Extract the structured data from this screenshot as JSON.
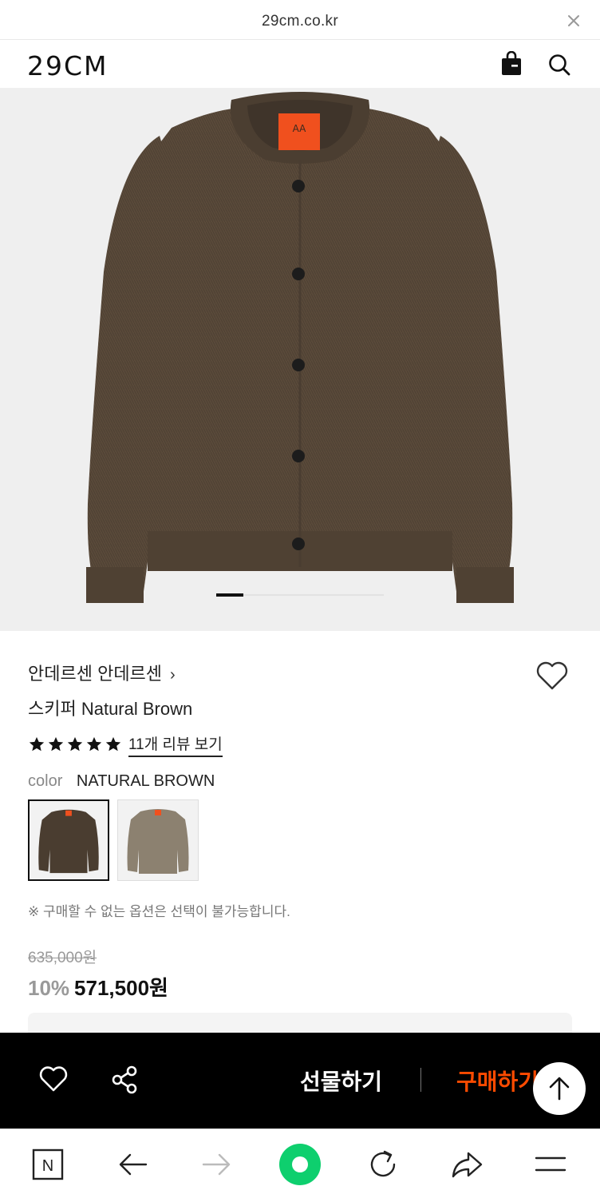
{
  "browser": {
    "url": "29cm.co.kr",
    "close_icon": "close-icon"
  },
  "header": {
    "logo": "29CM",
    "icons": [
      "shopping-bag-icon",
      "search-icon"
    ]
  },
  "gallery": {
    "active_slide": 1
  },
  "product": {
    "brand_label": "안데르센 안데르센",
    "brand_chevron": "›",
    "name": "스키퍼 Natural Brown",
    "rating_stars": 5,
    "review_link": "11개 리뷰 보기",
    "color_label": "color",
    "color_value": "NATURAL BROWN",
    "swatches": [
      {
        "name": "natural-brown",
        "selected": true,
        "color": "#4a3d30"
      },
      {
        "name": "beige",
        "selected": false,
        "color": "#8c8170"
      }
    ],
    "notice": "※ 구매할 수 없는 옵션은 선택이 불가능합니다.",
    "original_price": "635,000원",
    "discount": "10%",
    "price": "571,500원"
  },
  "buy_bar": {
    "gift_label": "선물하기",
    "buy_label": "구매하기",
    "accent_color": "#ff4b00"
  },
  "toolbar": {
    "icons": [
      "naver-n-icon",
      "back-arrow-icon",
      "forward-arrow-icon",
      "home-circle-icon",
      "refresh-icon",
      "share-arrow-icon",
      "menu-icon"
    ],
    "n_label": "N"
  }
}
